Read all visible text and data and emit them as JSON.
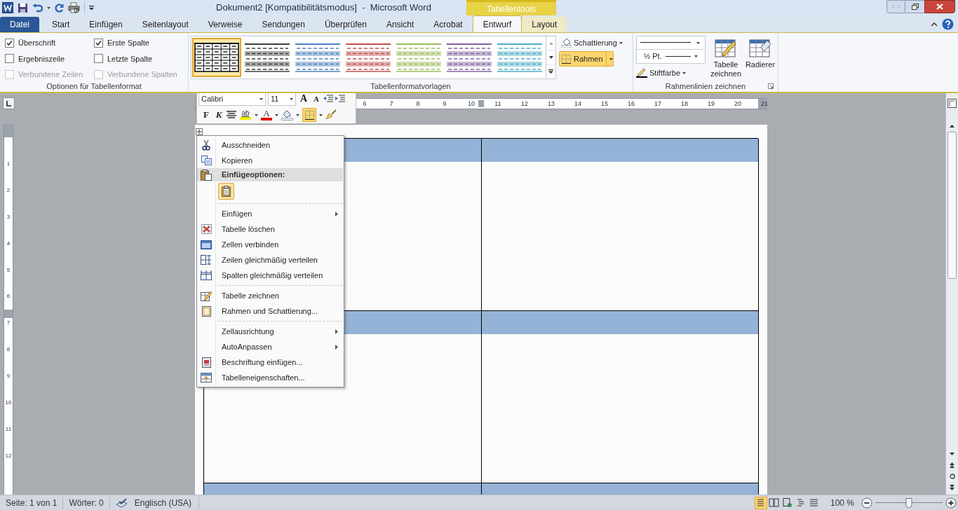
{
  "title_bar": {
    "title": "Dokument2 [Kompatibilitätsmodus]  -  Microsoft Word",
    "context_label": "Tabellentools"
  },
  "tabs": [
    {
      "label": "Datei",
      "kind": "file",
      "selected": false
    },
    {
      "label": "Start",
      "kind": "tab",
      "selected": false
    },
    {
      "label": "Einfügen",
      "kind": "tab",
      "selected": false
    },
    {
      "label": "Seitenlayout",
      "kind": "tab",
      "selected": false
    },
    {
      "label": "Verweise",
      "kind": "tab",
      "selected": false
    },
    {
      "label": "Sendungen",
      "kind": "tab",
      "selected": false
    },
    {
      "label": "Überprüfen",
      "kind": "tab",
      "selected": false
    },
    {
      "label": "Ansicht",
      "kind": "tab",
      "selected": false
    },
    {
      "label": "Acrobat",
      "kind": "tab",
      "selected": false
    },
    {
      "label": "Entwurf",
      "kind": "context",
      "selected": true
    },
    {
      "label": "Layout",
      "kind": "context",
      "selected": false
    }
  ],
  "options_group": {
    "label": "Optionen für Tabellenformat",
    "checkboxes": [
      {
        "label": "Überschrift",
        "checked": true,
        "disabled": false
      },
      {
        "label": "Erste Spalte",
        "checked": true,
        "disabled": false
      },
      {
        "label": "Ergebniszeile",
        "checked": false,
        "disabled": false
      },
      {
        "label": "Letzte Spalte",
        "checked": false,
        "disabled": false
      },
      {
        "label": "Verbundene Zeilen",
        "checked": false,
        "disabled": true
      },
      {
        "label": "Verbundene Spalten",
        "checked": false,
        "disabled": true
      }
    ]
  },
  "styles_group": {
    "label": "Tabellenformatvorlagen",
    "styles": [
      {
        "color": "#000000",
        "selected": true
      },
      {
        "color": "#404040",
        "selected": false
      },
      {
        "color": "#4f81bd",
        "selected": false
      },
      {
        "color": "#c0504d",
        "selected": false
      },
      {
        "color": "#9bbb59",
        "selected": false
      },
      {
        "color": "#8064a2",
        "selected": false
      },
      {
        "color": "#4bacc6",
        "selected": false
      }
    ],
    "shading": "Schattierung",
    "borders": {
      "label": "Rahmen",
      "active": true
    }
  },
  "borders_group": {
    "label": "Rahmenlinien zeichnen",
    "pen_weight": "½ Pt.",
    "pen_color": "Stiftfarbe",
    "draw_table": "Tabelle zeichnen",
    "eraser": "Radierer"
  },
  "ruler": {
    "numbers": [
      "6",
      "7",
      "8",
      "9",
      "10",
      "11",
      "12",
      "13",
      "14",
      "15",
      "16",
      "17",
      "18",
      "19",
      "20",
      "21"
    ]
  },
  "vertical_ruler": {
    "numbers": [
      "1",
      "2",
      "3",
      "4",
      "5",
      "6",
      "7",
      "8",
      "9",
      "10",
      "11",
      "12"
    ]
  },
  "mini_toolbar": {
    "font": "Calibri",
    "size": "11",
    "grow_font": "A",
    "shrink_font": "A",
    "bold": "F",
    "italic": "K",
    "highlight": "ab",
    "font_color": "A",
    "borders_active": true
  },
  "context_menu": [
    {
      "kind": "item",
      "label": "Ausschneiden",
      "submenu": false
    },
    {
      "kind": "item",
      "label": "Kopieren",
      "submenu": false
    },
    {
      "kind": "heading",
      "label": "Einfügeoptionen:"
    },
    {
      "kind": "paste_option"
    },
    {
      "kind": "separator"
    },
    {
      "kind": "item",
      "label": "Einfügen",
      "submenu": true
    },
    {
      "kind": "item",
      "label": "Tabelle löschen",
      "submenu": false
    },
    {
      "kind": "item",
      "label": "Zellen verbinden",
      "submenu": false
    },
    {
      "kind": "item",
      "label": "Zeilen gleichmäßig verteilen",
      "submenu": false
    },
    {
      "kind": "item",
      "label": "Spalten gleichmäßig verteilen",
      "submenu": false
    },
    {
      "kind": "separator"
    },
    {
      "kind": "item",
      "label": "Tabelle zeichnen",
      "submenu": false
    },
    {
      "kind": "item",
      "label": "Rahmen und Schattierung...",
      "submenu": false
    },
    {
      "kind": "separator"
    },
    {
      "kind": "item",
      "label": "Zellausrichtung",
      "submenu": true
    },
    {
      "kind": "item",
      "label": "AutoAnpassen",
      "submenu": true
    },
    {
      "kind": "item",
      "label": "Beschriftung einfügen...",
      "submenu": false
    },
    {
      "kind": "item",
      "label": "Tabelleneigenschaften...",
      "submenu": false
    }
  ],
  "status_bar": {
    "page": "Seite: 1 von 1",
    "words": "Wörter: 0",
    "language": "Englisch (USA)",
    "views": [
      {
        "selected": true
      },
      {
        "selected": false
      },
      {
        "selected": false
      },
      {
        "selected": false
      },
      {
        "selected": false
      }
    ],
    "zoom": "100 %",
    "zoom_slider": {
      "level": 0.5
    }
  }
}
